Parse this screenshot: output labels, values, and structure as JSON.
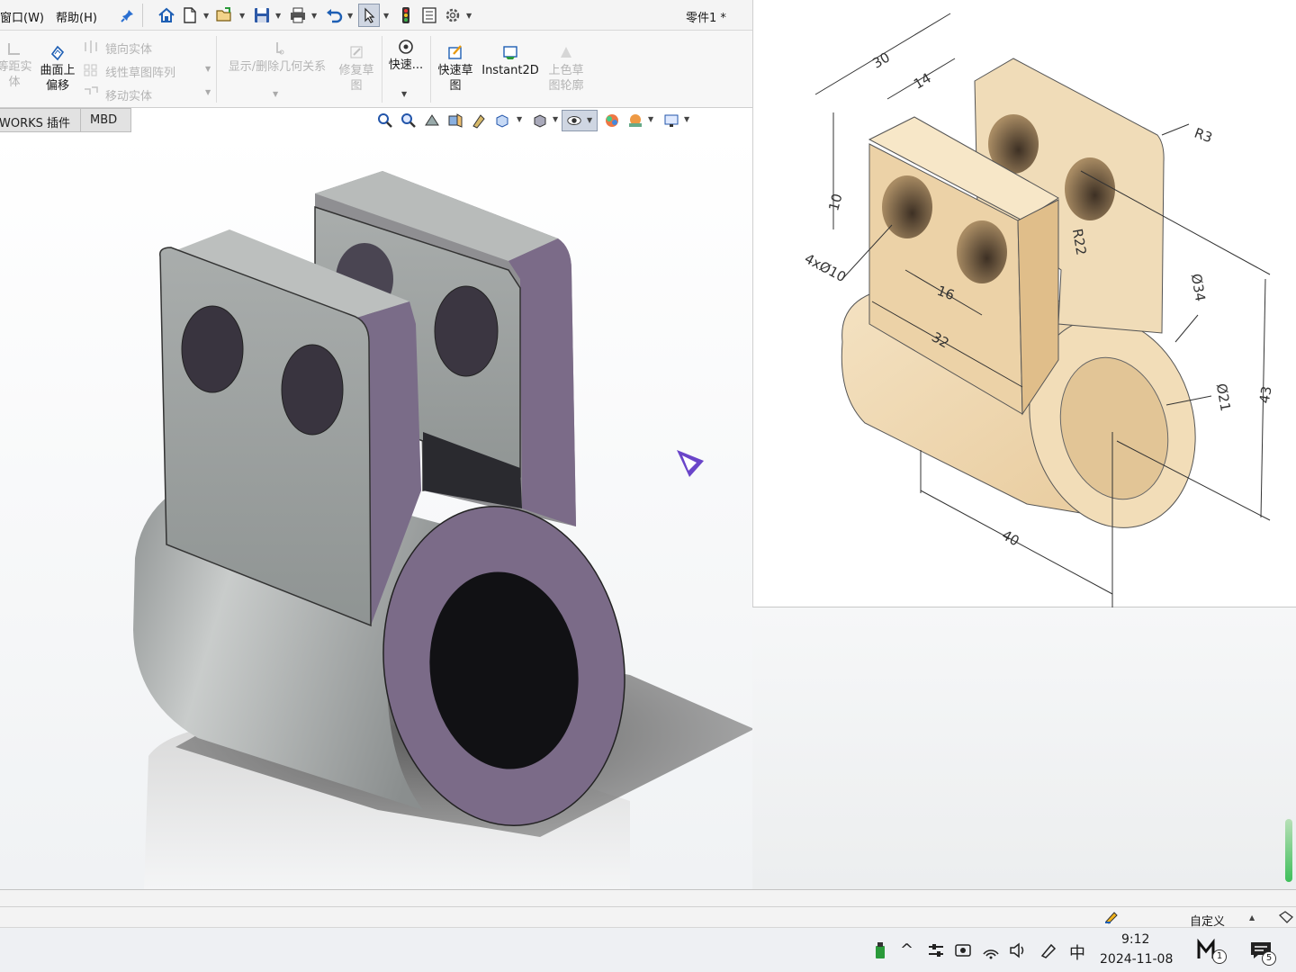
{
  "menu": {
    "window": "窗口(W)",
    "help": "帮助(H)"
  },
  "document": {
    "title": "零件1 *"
  },
  "ribbon": {
    "offset_solid": "等距实\n体",
    "surface_offset_line1": "曲面上",
    "surface_offset_line2": "偏移",
    "mirror_entities": "镜向实体",
    "linear_pattern": "线性草图阵列",
    "move_entities": "移动实体",
    "show_relations": "显示/删除几何关系",
    "repair_sketch_line1": "修复草",
    "repair_sketch_line2": "图",
    "quick_snap": "快速...",
    "rapid_sketch_line1": "快速草",
    "rapid_sketch_line2": "图",
    "instant2d": "Instant2D",
    "shaded_contours_line1": "上色草",
    "shaded_contours_line2": "图轮廓"
  },
  "tabs": [
    "WORKS 插件",
    "MBD"
  ],
  "reference_drawing": {
    "dimensions": [
      "30",
      "14",
      "R3",
      "10",
      "4xØ10",
      "R22",
      "16",
      "32",
      "Ø34",
      "Ø21",
      "43",
      "40"
    ]
  },
  "status": {
    "units": "自定义"
  },
  "taskbar": {
    "ime": "中",
    "time": "9:12",
    "date": "2024-11-08",
    "app_badge": "1",
    "notif_badge": "5"
  },
  "colors": {
    "part_grey": "#9fa3a3",
    "part_purple": "#7b6b88",
    "reference_tan": "#efd8b0",
    "accent": "#1e5fb4"
  },
  "icons": [
    "home-icon",
    "new-file-icon",
    "open-icon",
    "save-icon",
    "print-icon",
    "undo-icon",
    "select-icon",
    "traffic-light-icon",
    "file-properties-icon",
    "options-gear-icon",
    "pin-icon"
  ]
}
